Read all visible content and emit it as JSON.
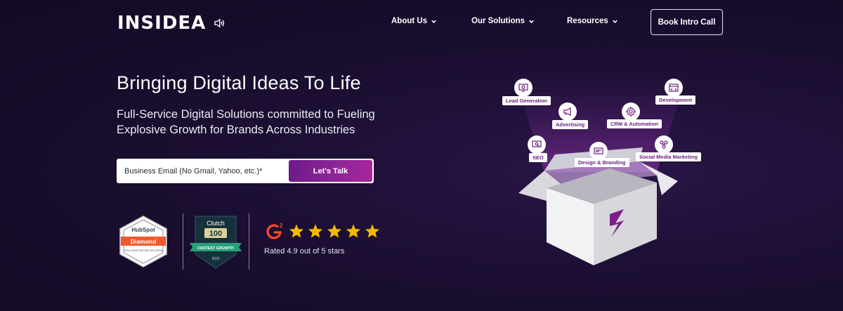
{
  "header": {
    "logo": "INSIDEA",
    "nav": [
      {
        "label": "About Us"
      },
      {
        "label": "Our Solutions"
      },
      {
        "label": "Resources"
      }
    ],
    "cta": "Book Intro Call"
  },
  "hero": {
    "title": "Bringing Digital Ideas To Life",
    "subtitle": "Full-Service Digital Solutions committed to Fueling Explosive Growth for Brands Across Industries",
    "email_placeholder": "Business Email (No Gmail, Yahoo, etc.)*",
    "submit_label": "Let's Talk"
  },
  "badges": {
    "hubspot": {
      "brand": "HubSpot",
      "tier": "Diamond",
      "caption": "SOLUTIONS PARTNER PROGRAM"
    },
    "clutch": {
      "brand": "Clutch",
      "rank": "100",
      "ribbon": "FASTEST GROWTH",
      "year": "2025"
    },
    "g2": {
      "logo": "G2",
      "stars": 5,
      "rating_text": "Rated 4.9 out of 5 stars"
    }
  },
  "illustration": {
    "services": [
      {
        "label": "Lead Generation",
        "icon": "monitor-target-icon"
      },
      {
        "label": "Development",
        "icon": "code-window-icon"
      },
      {
        "label": "Advertising",
        "icon": "megaphone-icon"
      },
      {
        "label": "CRM & Automation",
        "icon": "gear-cycle-icon"
      },
      {
        "label": "SEO",
        "icon": "seo-search-icon"
      },
      {
        "label": "Design & Branding",
        "icon": "design-palette-icon"
      },
      {
        "label": "Social Media Marketing",
        "icon": "social-network-icon"
      }
    ],
    "box_logo": "S"
  },
  "colors": {
    "background": "#170c2b",
    "accent": "#8b2398",
    "hubspot_orange": "#f1592a",
    "star": "#f5b800",
    "g2_red": "#ff492c",
    "clutch_green": "#17313b"
  }
}
